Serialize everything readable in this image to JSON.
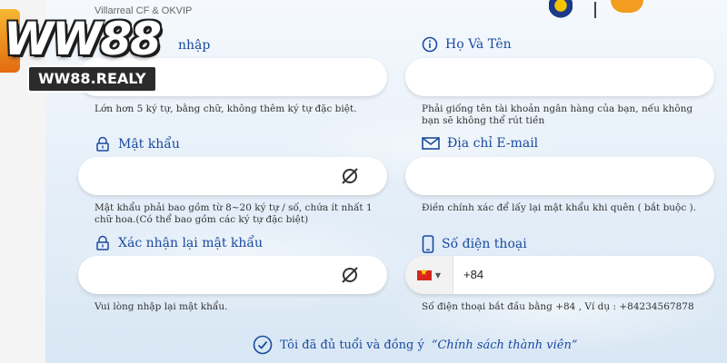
{
  "header": {
    "top_text": "Villarreal CF & OKVIP"
  },
  "brand": {
    "logo_text": "WW88",
    "url": "WW88.REALY"
  },
  "form": {
    "username": {
      "label": "Tên đăng nhập",
      "label_visible": "nhập",
      "value": "",
      "hint": "Lớn hơn 5 ký tự, bằng chữ, không thêm ký tự đặc biệt."
    },
    "fullname": {
      "label": "Họ Và Tên",
      "value": "",
      "hint": "Phải giống tên tài khoản ngân hàng của bạn, nếu không bạn sẽ không thể rút tiền"
    },
    "password": {
      "label": "Mật khẩu",
      "value": "",
      "hint": "Mật khẩu phải bao gồm từ 8~20 ký tự / số, chứa ít nhất 1 chữ hoa.(Có thể bao gồm các ký tự đặc biệt)"
    },
    "email": {
      "label": "Địa chỉ E-mail",
      "value": "",
      "hint": "Điền chính xác để lấy lại mật khẩu khi quên ( bắt buộc )."
    },
    "confirm_password": {
      "label": "Xác nhận lại mật khẩu",
      "value": "",
      "hint": "Vui lòng nhập lại mật khẩu."
    },
    "phone": {
      "label": "Số điện thoại",
      "country_code": "+84",
      "value": "",
      "hint": "Số điện thoại bắt đầu bằng +84 , Ví dụ : +84234567878"
    },
    "agreement": {
      "text": "Tôi đã đủ tuổi và đồng ý",
      "link": "“Chính sách thành viên”"
    }
  },
  "colors": {
    "label_blue": "#1a4aa0",
    "flag_red": "#da251d",
    "flag_star": "#ffde00"
  }
}
